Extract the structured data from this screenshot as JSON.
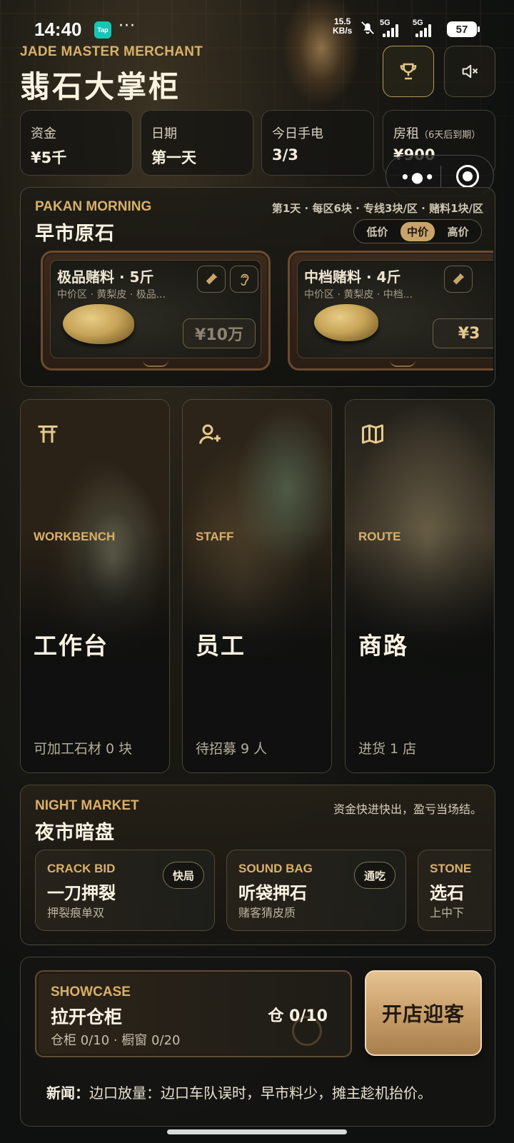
{
  "status_bar": {
    "time": "14:40",
    "app_badge": "Tap",
    "more": "···",
    "net_speed_value": "15.5",
    "net_speed_unit": "KB/s",
    "signal1_label": "5G",
    "signal2_label": "5G",
    "battery": "57"
  },
  "header": {
    "subtitle": "JADE MASTER MERCHANT",
    "title": "翡石大掌柜",
    "trophy_icon": "trophy-icon",
    "sound_icon": "speaker-mute-icon"
  },
  "stats": [
    {
      "label": "资金",
      "value": "¥5千"
    },
    {
      "label": "日期",
      "value": "第一天"
    },
    {
      "label": "今日手电",
      "value": "3/3"
    },
    {
      "label": "房租",
      "note": "（6天后到期）",
      "value": "¥900"
    }
  ],
  "morning": {
    "en": "PAKAN MORNING",
    "cn": "早市原石",
    "info": "第1天 · 每区6块 · 专线3块/区 · 赌料1块/区",
    "tabs": [
      "低价",
      "中价",
      "高价"
    ],
    "active_tab": "中价",
    "ores": [
      {
        "name": "极品赌料 · 5斤",
        "meta": "中价区 · 黄梨皮 · 极品...",
        "price": "¥10万"
      },
      {
        "name": "中档赌料 · 4斤",
        "meta": "中价区 · 黄梨皮 · 中档...",
        "price": "¥3"
      }
    ]
  },
  "features": [
    {
      "en": "WORKBENCH",
      "cn": "工作台",
      "footer": "可加工石材 0 块",
      "icon": "gate-icon"
    },
    {
      "en": "STAFF",
      "cn": "员工",
      "footer": "待招募 9 人",
      "icon": "add-user-icon"
    },
    {
      "en": "ROUTE",
      "cn": "商路",
      "footer": "进货 1 店",
      "icon": "map-icon"
    }
  ],
  "night": {
    "en": "NIGHT MARKET",
    "cn": "夜市暗盘",
    "note": "资金快进快出，盈亏当场结。",
    "modes": [
      {
        "en": "CRACK BID",
        "cn": "一刀押裂",
        "sub": "押裂痕单双",
        "tag": "快局"
      },
      {
        "en": "SOUND BAG",
        "cn": "听袋押石",
        "sub": "赌客猜皮质",
        "tag": "通吃"
      },
      {
        "en": "STONE",
        "cn": "选石",
        "sub": "上中下",
        "tag": ""
      }
    ]
  },
  "showcase": {
    "en": "SHOWCASE",
    "cn": "拉开仓柜",
    "sub": "仓柜 0/10 · 橱窗 0/20",
    "count": "仓 0/10",
    "open_button": "开店迎客"
  },
  "news": {
    "label": "新闻：",
    "text": "边口放量：边口车队误时，早市料少，摊主趁机抬价。"
  },
  "colors": {
    "accent_gold": "#d9b06a",
    "button_gold": "#c59b66",
    "panel_bg": "#161613"
  }
}
